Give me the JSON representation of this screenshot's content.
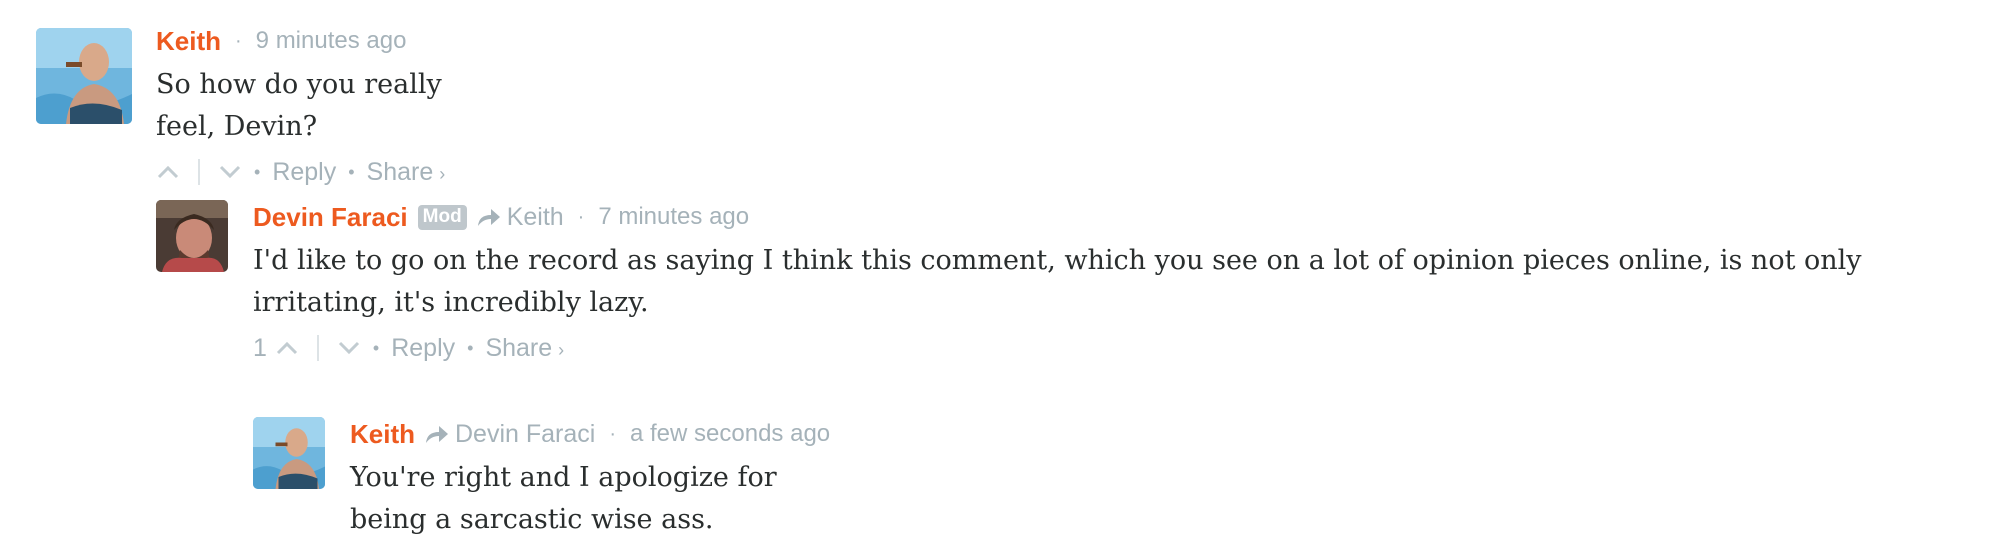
{
  "comments": [
    {
      "author": "Keith",
      "time": "9 minutes ago",
      "message": "So how do you really feel, Devin?",
      "vote_count": "",
      "reply_label": "Reply",
      "share_label": "Share",
      "share_caret": "›"
    },
    {
      "author": "Devin Faraci",
      "badge": "Mod",
      "in_reply_to": "Keith",
      "time": "7 minutes ago",
      "message": "I'd like to go on the record as saying I think this comment, which you see on a lot of opinion pieces online, is not only irritating, it's incredibly lazy.",
      "vote_count": "1",
      "reply_label": "Reply",
      "share_label": "Share",
      "share_caret": "›"
    },
    {
      "author": "Keith",
      "in_reply_to": "Devin Faraci",
      "time": "a few seconds ago",
      "message": "You're right and I apologize for being a sarcastic wise ass."
    }
  ],
  "colors": {
    "author": "#ed5a1f",
    "meta": "#a5b2b9",
    "text": "#2a2e2e",
    "badge_bg": "#bfc7cc"
  },
  "icons": [
    "upvote-chevron-icon",
    "downvote-chevron-icon",
    "reply-arrow-icon"
  ]
}
